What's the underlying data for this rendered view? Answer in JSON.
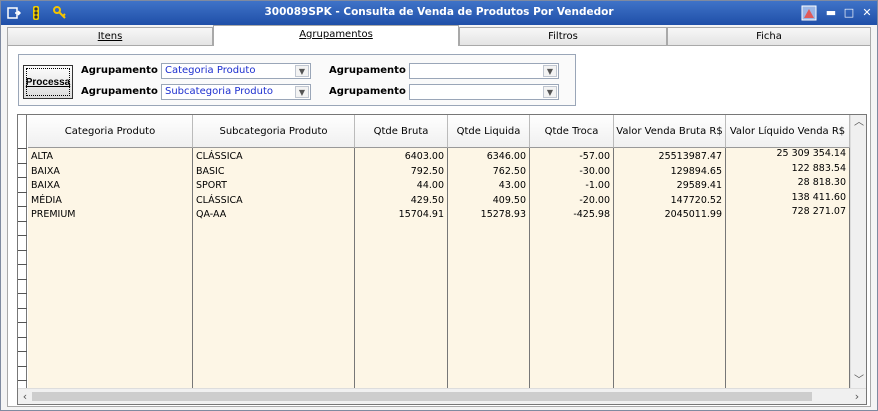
{
  "window": {
    "title": "300089SPK - Consulta de Venda de Produtos Por Vendedor"
  },
  "tabs": [
    {
      "label": "Itens",
      "active": false
    },
    {
      "label": "Agrupamentos",
      "active": true
    },
    {
      "label": "Filtros",
      "active": false
    },
    {
      "label": "Ficha",
      "active": false
    }
  ],
  "grouping": {
    "process_label": "Processa",
    "g1_label": "Agrupamento 1",
    "g1_value": "Categoria Produto",
    "g2_label": "Agrupamento 2",
    "g2_value": "Subcategoria Produto",
    "g3_label": "Agrupamento 3",
    "g3_value": "",
    "g4_label": "Agrupamento 4",
    "g4_value": ""
  },
  "grid": {
    "columns": [
      "Categoria Produto",
      "Subcategoria Produto",
      "Qtde Bruta",
      "Qtde Liquida",
      "Qtde Troca",
      "Valor Venda Bruta R$",
      "Valor Líquido Venda R$"
    ],
    "rows": [
      [
        "ALTA",
        "CLÁSSICA",
        "6403.00",
        "6346.00",
        "-57.00",
        "25513987.47",
        "25 309 354.14"
      ],
      [
        "BAIXA",
        "BASIC",
        "792.50",
        "762.50",
        "-30.00",
        "129894.65",
        "122 883.54"
      ],
      [
        "BAIXA",
        "SPORT",
        "44.00",
        "43.00",
        "-1.00",
        "29589.41",
        "28 818.30"
      ],
      [
        "MÉDIA",
        "CLÁSSICA",
        "429.50",
        "409.50",
        "-20.00",
        "147720.52",
        "138 411.60"
      ],
      [
        "PREMIUM",
        "QA-AA",
        "15704.91",
        "15278.93",
        "-425.98",
        "2045011.99",
        "728 271.07"
      ]
    ]
  },
  "icons": {
    "menu": "menu-icon",
    "traffic": "traffic-light-icon",
    "key": "key-icon"
  }
}
